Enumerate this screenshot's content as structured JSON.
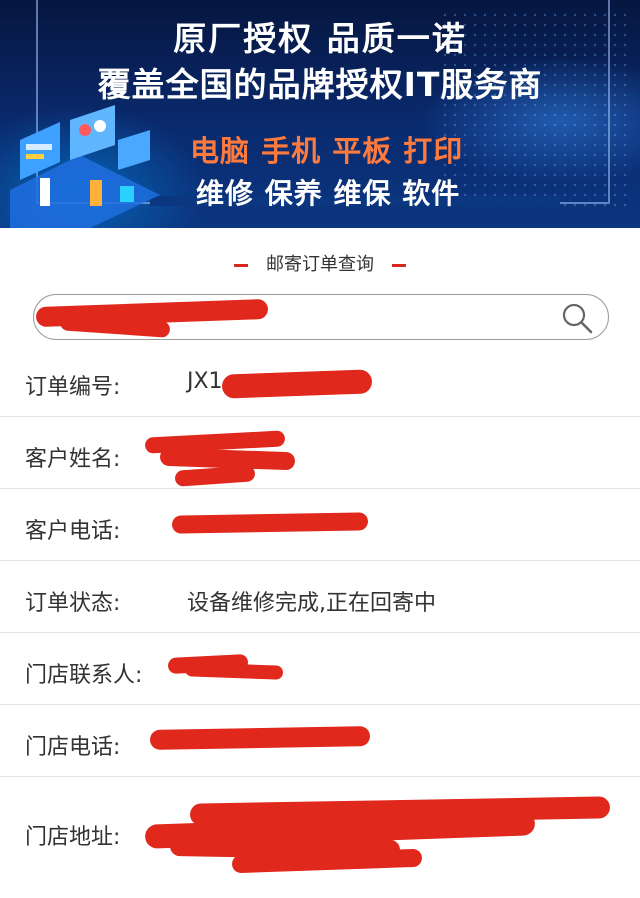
{
  "banner": {
    "line1": "原厂授权  品质一诺",
    "line2": "覆盖全国的品牌授权IT服务商",
    "line3": "电脑 手机 平板 打印",
    "line4": "维修 保养 维保 软件"
  },
  "section_title": "邮寄订单查询",
  "search": {
    "value": "",
    "icon": "search-icon"
  },
  "fields": [
    {
      "label": "订单编号:",
      "value": "JX1"
    },
    {
      "label": "客户姓名:",
      "value": ""
    },
    {
      "label": "客户电话:",
      "value": ""
    },
    {
      "label": "订单状态:",
      "value": "设备维修完成,正在回寄中"
    },
    {
      "label": "门店联系人:",
      "value": ""
    },
    {
      "label": "门店电话:",
      "value": ""
    },
    {
      "label": "门店地址:",
      "value": ""
    }
  ],
  "colors": {
    "accent": "#d9261c",
    "redaction": "#e0281c",
    "banner_bg": "#0a2a6e",
    "banner_highlight": "#ff7a3d"
  }
}
